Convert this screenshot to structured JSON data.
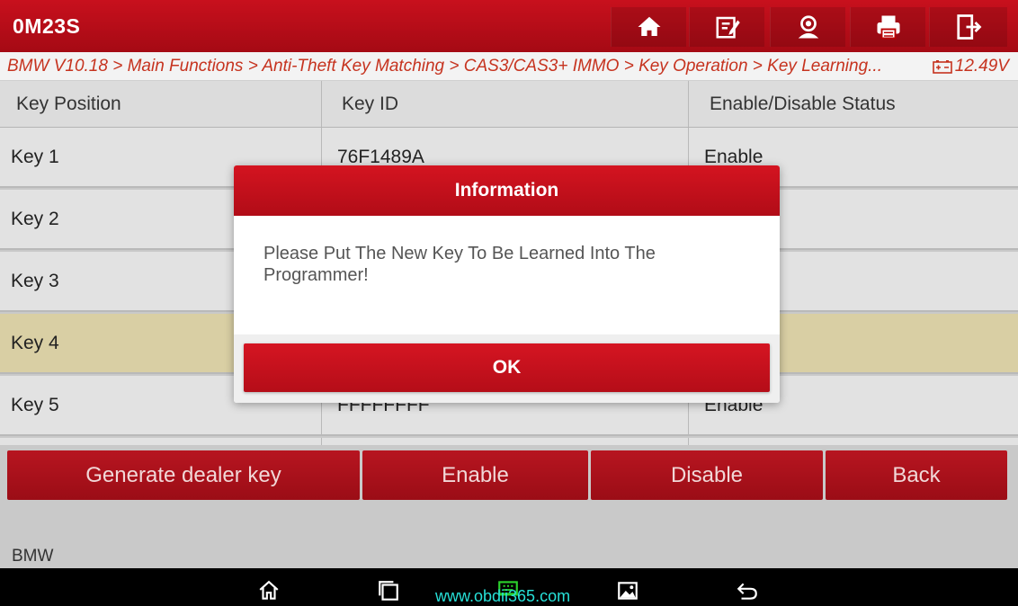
{
  "topbar": {
    "title": "0M23S",
    "buttons": [
      {
        "name": "home-icon"
      },
      {
        "name": "edit-report-icon"
      },
      {
        "name": "user-icon"
      },
      {
        "name": "printer-icon"
      },
      {
        "name": "exit-icon"
      }
    ]
  },
  "breadcrumb": {
    "text": "BMW V10.18 > Main Functions  > Anti-Theft Key Matching > CAS3/CAS3+ IMMO  > Key Operation  > Key Learning...",
    "battery_icon": "battery-icon",
    "voltage": "12.49V"
  },
  "table": {
    "headers": [
      "Key Position",
      "Key ID",
      "Enable/Disable Status"
    ],
    "rows": [
      {
        "position": "Key 1",
        "id": "76F1489A",
        "status": "Enable"
      },
      {
        "position": "Key 2",
        "id": "",
        "status": ""
      },
      {
        "position": "Key 3",
        "id": "",
        "status": ""
      },
      {
        "position": "Key 4",
        "id": "",
        "status": "",
        "selected": true
      },
      {
        "position": "Key 5",
        "id": "FFFFFFFF",
        "status": "Enable"
      }
    ]
  },
  "actions": {
    "generate": "Generate dealer key",
    "enable": "Enable",
    "disable": "Disable",
    "back": "Back"
  },
  "footer": {
    "label": "BMW"
  },
  "dialog": {
    "title": "Information",
    "message": "Please Put The New Key To Be Learned Into The Programmer!",
    "ok": "OK"
  },
  "navbar": {
    "watermark": "www.obdii365.com"
  },
  "colors": {
    "brand_red": "#c8101d",
    "breadcrumb_text": "#c6331f",
    "selected_row": "#d9cfa4",
    "watermark": "#27e0d8"
  }
}
